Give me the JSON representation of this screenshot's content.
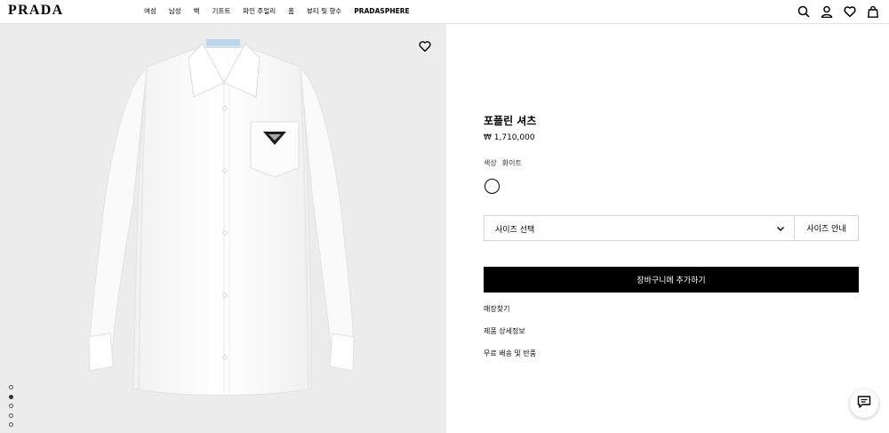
{
  "header": {
    "logo": "PRADA",
    "nav": [
      "여성",
      "남성",
      "백",
      "기프트",
      "파인 주얼리",
      "홈",
      "뷰티 및 향수",
      "PRADASPHERE"
    ],
    "icons": [
      "search-icon",
      "account-icon",
      "wishlist-icon",
      "bag-icon"
    ]
  },
  "gallery": {
    "image": "white-poplin-shirt",
    "slides": 5,
    "active_slide": 2
  },
  "product": {
    "title": "포플린 셔츠",
    "price": "₩ 1,710,000",
    "color_label": "색상",
    "color_value": "화이트",
    "size_select": "사이즈 선택",
    "size_guide": "사이즈 안내",
    "add_to_cart": "장바구니에 추가하기",
    "links": [
      "매장찾기",
      "제품 상세정보",
      "무료 배송 및 반품"
    ]
  },
  "colors": {
    "accent": "#000000",
    "gallery_bg": "#ececec",
    "shirt": "#ffffff"
  }
}
